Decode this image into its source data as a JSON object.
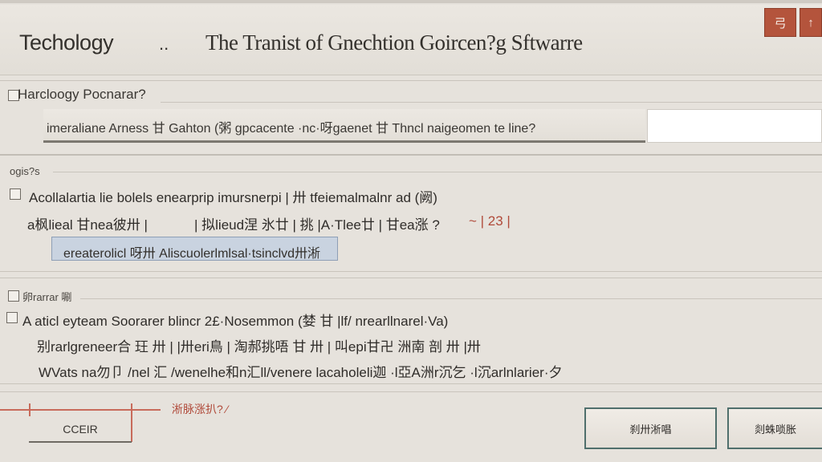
{
  "window": {
    "app_title": "Techology",
    "separator": "..",
    "document_title": "The Tranist of Gnechtion Goircen?g Sftwarre",
    "controls": {
      "minimize": "弓",
      "close": "↑"
    }
  },
  "section_one": {
    "heading": "Harcloogy Pocnarar?",
    "input_text": "imeraliane Arness 甘 Gahton (粥 gpcacente ·nc·呀gaenet 甘 Thncl naigeomen te line?"
  },
  "section_two": {
    "heading": "ogis?s",
    "line1": "Acollalartia lie bolels enearprip imursnerpi | 卅 tfeiemalmalnr ad (阙)",
    "line2_left": "a枫lieal 甘nea彼卅 |",
    "line2_mid": "| 拟lieud涅 氷廿 | 挑 |A·Tlee廿 | 甘ea涨 ?",
    "line2_red": "~ | 23 |",
    "highlight": "ereaterolicl 呀卅    Aliscuolerlmlsal·tsinclvd卅淅"
  },
  "section_three": {
    "heading": "卵rarrar 唰",
    "line1": "A aticl eyteam Soorarer blincr 2£·Nosemmon (婪 甘 |lf/ nrearllnarel·Va)",
    "line2": "别rarlgreneer合 玨 卅 |   |卅eri鳥 |   淘郝挑唔 甘 卅 | 叫epi甘卍 洲南 剖 卅    |卅",
    "line3": "WVats na勿卩 /nel 汇 /wenelhe和n汇ll/venere lacaholeli迦 ·l亞A洲r沉乞 ·l沉arlnlarier·夕"
  },
  "footer": {
    "note": "淅脉涨扒? ⁄",
    "cancel_label": "CCEIR",
    "buttons": [
      "刹卅淅唱",
      "剡蛛唢胀"
    ]
  }
}
